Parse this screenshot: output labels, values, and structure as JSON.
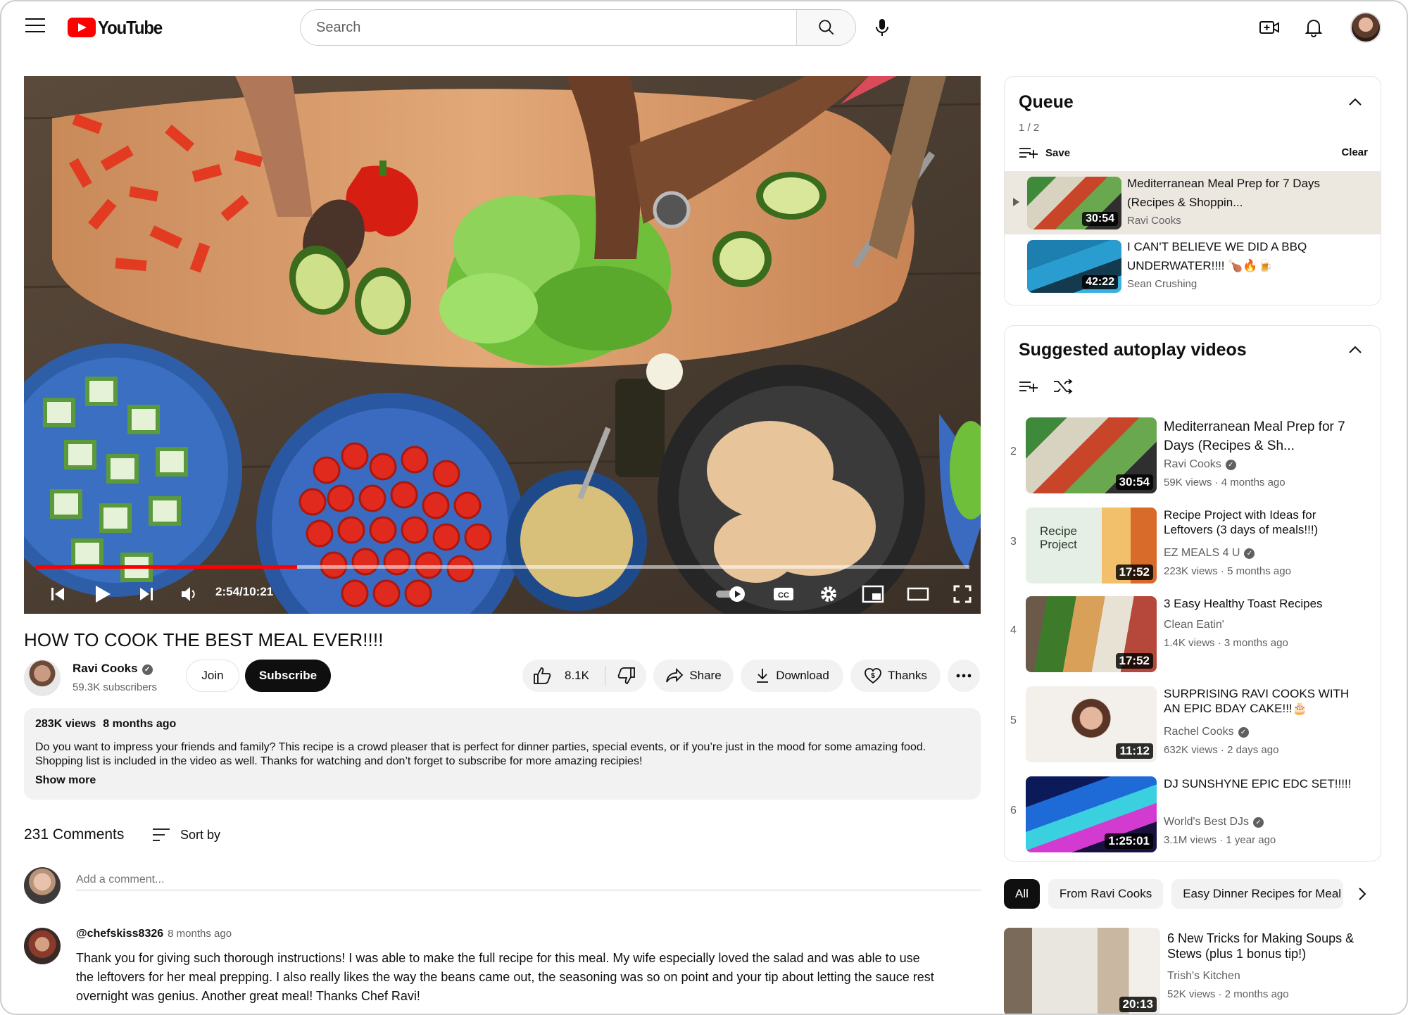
{
  "header": {
    "logo_text": "YouTube",
    "search_placeholder": "Search"
  },
  "player": {
    "time_display": "2:54/10:21",
    "progress": 0.28
  },
  "video": {
    "title": "HOW TO COOK THE BEST MEAL EVER!!!!",
    "channel": "Ravi Cooks",
    "subscribers": "59.3K subscribers",
    "join_label": "Join",
    "subscribe_label": "Subscribe",
    "likes": "8.1K",
    "share_label": "Share",
    "download_label": "Download",
    "thanks_label": "Thanks"
  },
  "description": {
    "views": "283K views",
    "age": "8 months ago",
    "text": "Do you want to impress your friends and family? This recipe is a crowd pleaser that is perfect for dinner parties, special events, or if you’re just in the mood for some amazing food. Shopping list is included in the video as well. Thanks for watching and don’t forget to subscribe for more amazing recipies!",
    "show_more": "Show more"
  },
  "comments": {
    "count": "231 Comments",
    "sort_label": "Sort by",
    "add_placeholder": "Add a comment...",
    "first": {
      "user": "@chefskiss8326",
      "time": "8 months ago",
      "text": "Thank you for giving such thorough instructions! I was able to make the full recipe for this meal. My wife especially loved the salad and was able to use the leftovers for her meal prepping. I also really likes the way the beans came out, the seasoning was so on point and your tip about letting the sauce rest overnight was genius. Another great meal! Thanks Chef Ravi!"
    }
  },
  "queue": {
    "title": "Queue",
    "count": "1 / 2",
    "save_label": "Save",
    "clear_label": "Clear",
    "items": [
      {
        "title": "Mediterranean Meal Prep for 7 Days (Recipes & Shoppin...",
        "channel": "Ravi Cooks",
        "duration": "30:54"
      },
      {
        "title": "I CAN'T BELIEVE WE DID A BBQ UNDERWATER!!!! 🍗🔥🍺",
        "channel": "Sean Crushing",
        "duration": "42:22"
      }
    ]
  },
  "suggested": {
    "title": "Suggested autoplay videos",
    "items": [
      {
        "index": "2",
        "title": "Mediterranean Meal Prep for 7 Days (Recipes & Sh...",
        "channel": "Ravi Cooks",
        "views": "59K views",
        "age": "4 months ago",
        "duration": "30:54"
      },
      {
        "index": "3",
        "title": "Recipe Project with Ideas for Leftovers (3 days of meals!!!)",
        "channel": "EZ MEALS 4 U",
        "views": "223K views",
        "age": "5 months ago",
        "duration": "17:52",
        "thumb_text": "Recipe Project"
      },
      {
        "index": "4",
        "title": "3 Easy Healthy Toast Recipes",
        "channel": "Clean Eatin'",
        "views": "1.4K views",
        "age": "3 months ago",
        "duration": "17:52"
      },
      {
        "index": "5",
        "title": "SURPRISING RAVI COOKS WITH AN EPIC BDAY CAKE!!!🎂",
        "channel": "Rachel Cooks",
        "views": "632K views",
        "age": "2 days ago",
        "duration": "11:12"
      },
      {
        "index": "6",
        "title": "DJ SUNSHYNE EPIC EDC SET!!!!!",
        "channel": "World's Best DJs",
        "views": "3.1M views",
        "age": "1 year ago",
        "duration": "1:25:01"
      }
    ]
  },
  "chips": [
    "All",
    "From Ravi Cooks",
    "Easy Dinner Recipes for Meal"
  ],
  "recommended": {
    "title": "6 New Tricks for Making Soups & Stews (plus 1 bonus tip!)",
    "channel": "Trish's Kitchen",
    "views": "52K views",
    "age": "2 months ago",
    "duration": "20:13"
  }
}
